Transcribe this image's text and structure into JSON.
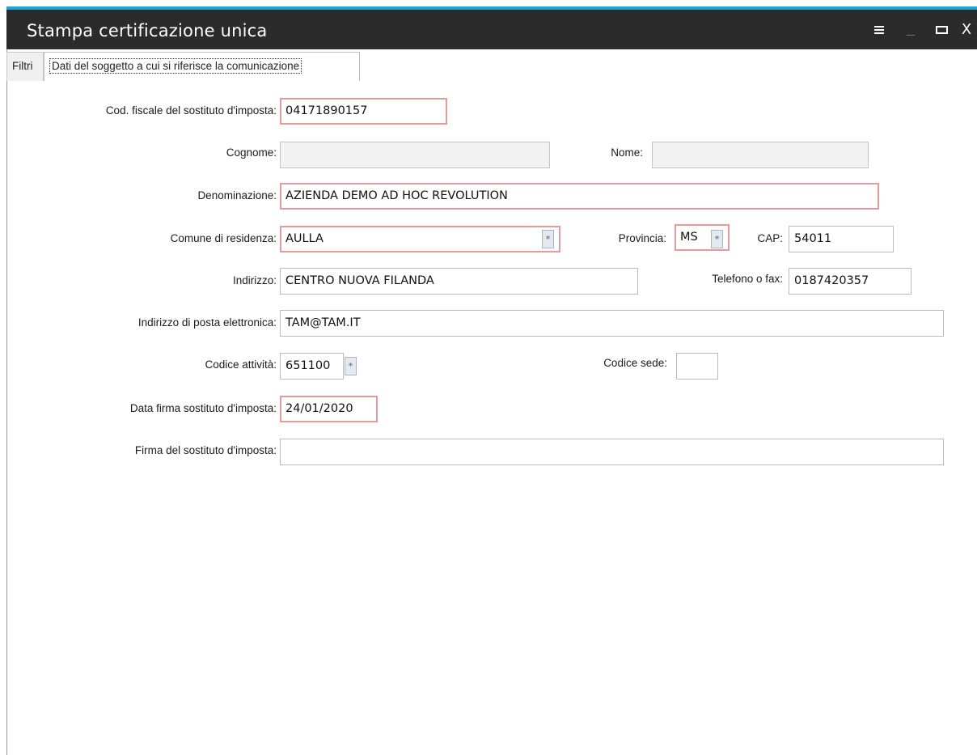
{
  "window": {
    "title": "Stampa certificazione unica",
    "accent_color": "#1ea6d8",
    "titlebar_color": "#2b2b2b",
    "controls": [
      "menu-icon",
      "minimize-icon",
      "maximize-icon",
      "close-icon"
    ],
    "close_glyph": "X"
  },
  "tabs": [
    {
      "label": "Filtri"
    },
    {
      "label": "Dati del soggetto a cui si riferisce la comunicazione",
      "active": true
    }
  ],
  "form": {
    "cod_fiscale": {
      "label": "Cod. fiscale del sostituto d'imposta:",
      "value": "04171890157"
    },
    "cognome": {
      "label": "Cognome:",
      "value": ""
    },
    "nome": {
      "label": "Nome:",
      "value": ""
    },
    "denominazione": {
      "label": "Denominazione:",
      "value": "AZIENDA DEMO AD HOC REVOLUTION"
    },
    "comune": {
      "label": "Comune di residenza:",
      "value": "AULLA"
    },
    "provincia": {
      "label": "Provincia:",
      "value": "MS"
    },
    "cap": {
      "label": "CAP:",
      "value": "54011"
    },
    "indirizzo": {
      "label": "Indirizzo:",
      "value": "CENTRO NUOVA FILANDA"
    },
    "telefono": {
      "label": "Telefono o fax:",
      "value": "0187420357"
    },
    "email": {
      "label": "Indirizzo di posta elettronica:",
      "value": "TAM@TAM.IT"
    },
    "codice_attivita": {
      "label": "Codice attività:",
      "value": "651100"
    },
    "codice_sede": {
      "label": "Codice sede:",
      "value": ""
    },
    "data_firma": {
      "label": "Data firma sostituto d'imposta:",
      "value": "24/01/2020"
    },
    "firma": {
      "label": "Firma del sostituto d'imposta:",
      "value": ""
    },
    "zoom_glyph": "*"
  },
  "colors": {
    "required_border": "#e79a9a",
    "disabled_background": "#f2f2f2"
  }
}
